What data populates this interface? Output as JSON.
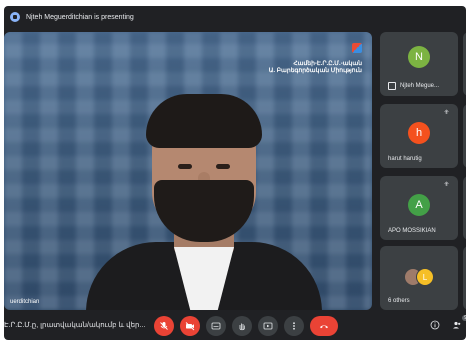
{
  "presenting_bar": {
    "text": "Njteh Meguerditchian is presenting"
  },
  "stage": {
    "logo_line1": "Համեի-Է.Ր.Ը.Մ.-ական",
    "logo_line2": "Ա. Բարեգործական Միություն",
    "presenter_name": "uerditchian"
  },
  "tiles": [
    {
      "avatar_letter": "N",
      "avatar_color": "#7cb342",
      "name": "Njteh Megue..."
    },
    {
      "avatar_letter": "h",
      "avatar_color": "#f4511e",
      "name": "harut harutig"
    },
    {
      "avatar_letter": "A",
      "avatar_color": "#43a047",
      "name": "APO MOSSIKIAN"
    },
    {
      "avatar_letter": "L",
      "avatar_color": "#f6bf26",
      "name": "6 others"
    }
  ],
  "bottom_bar": {
    "meeting_title": "Է.Ր.Ը.Մ.ը, լրատվական/ակումբ և վեր...",
    "people_count": "9"
  },
  "colors": {
    "background": "#202124",
    "tile": "#3c4043",
    "red": "#ea4335",
    "accent": "#8ab4f8"
  }
}
